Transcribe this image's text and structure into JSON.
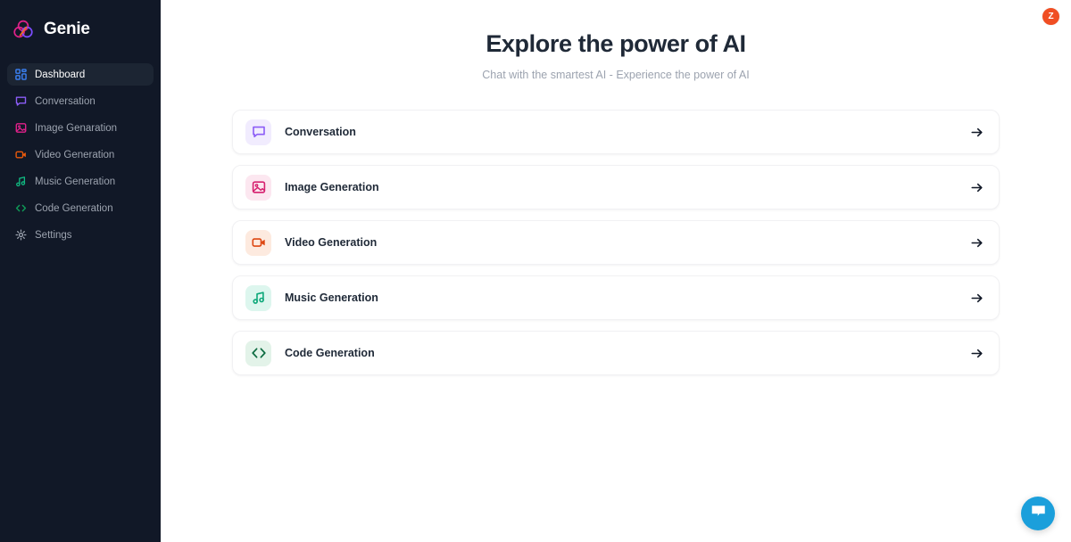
{
  "sidebar": {
    "brand": {
      "name": "Genie",
      "logo_icon": "genie-venn-logo-icon",
      "colors": [
        "#e0218a",
        "#f2711c",
        "#7c4dff"
      ]
    },
    "items": [
      {
        "label": "Dashboard",
        "icon": "grid-dashboard-icon",
        "color": "#3b82f6",
        "active": true
      },
      {
        "label": "Conversation",
        "icon": "message-square-icon",
        "color": "#8b5cf6",
        "active": false
      },
      {
        "label": "Image Genaration",
        "icon": "image-icon",
        "color": "#e0218a",
        "active": false
      },
      {
        "label": "Video Generation",
        "icon": "video-camera-icon",
        "color": "#e8590c",
        "active": false
      },
      {
        "label": "Music Generation",
        "icon": "music-note-icon",
        "color": "#10b981",
        "active": false
      },
      {
        "label": "Code Generation",
        "icon": "code-brackets-icon",
        "color": "#0f9d58",
        "active": false
      },
      {
        "label": "Settings",
        "icon": "gear-icon",
        "color": "#9ca3af",
        "active": false
      }
    ]
  },
  "header": {
    "avatar_initial": "Z",
    "avatar_color": "#f04e23"
  },
  "main": {
    "title": "Explore the power of AI",
    "subtitle": "Chat with the smartest AI - Experience the power of AI",
    "cards": [
      {
        "label": "Conversation",
        "icon": "message-square-icon",
        "color": "#8b5cf6",
        "tile": "tile-conversation",
        "arrow": "arrow-right-icon"
      },
      {
        "label": "Image Generation",
        "icon": "image-icon",
        "color": "#d6216f",
        "tile": "tile-image",
        "arrow": "arrow-right-icon"
      },
      {
        "label": "Video Generation",
        "icon": "video-camera-icon",
        "color": "#dd4712",
        "tile": "tile-video",
        "arrow": "arrow-right-icon"
      },
      {
        "label": "Music Generation",
        "icon": "music-note-icon",
        "color": "#0ea87a",
        "tile": "tile-music",
        "arrow": "arrow-right-icon"
      },
      {
        "label": "Code Generation",
        "icon": "code-brackets-icon",
        "color": "#0b6b40",
        "tile": "tile-code",
        "arrow": "arrow-right-icon"
      }
    ]
  },
  "chat_widget": {
    "icon": "chat-bubble-icon",
    "color": "#1b9fdb"
  }
}
